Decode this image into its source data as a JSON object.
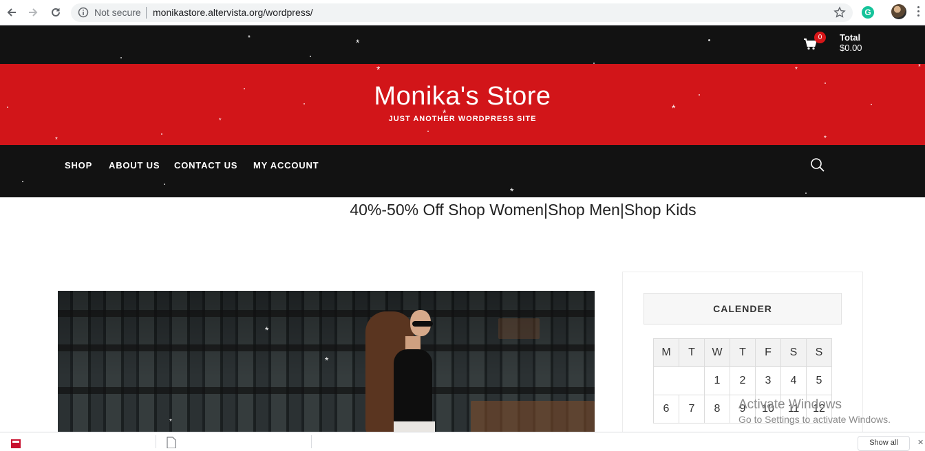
{
  "browser": {
    "security_label": "Not secure",
    "url": "monikastore.altervista.org/wordpress/",
    "extension_letter": "G"
  },
  "site": {
    "cart": {
      "count": "0",
      "total_label": "Total",
      "total_value": "$0.00"
    },
    "title": "Monika's Store",
    "tagline": "JUST ANOTHER WORDPRESS SITE",
    "nav": [
      "SHOP",
      "ABOUT US",
      "CONTACT US",
      "MY ACCOUNT"
    ],
    "promo": "40%-50% Off Shop Women|Shop Men|Shop Kids",
    "colors": {
      "topbar": "#121212",
      "banner": "#d21519",
      "badge": "#d71618"
    }
  },
  "calendar": {
    "title": "CALENDER",
    "days": [
      "M",
      "T",
      "W",
      "T",
      "F",
      "S",
      "S"
    ],
    "rows": [
      [
        "",
        "",
        "1",
        "2",
        "3",
        "4",
        "5"
      ],
      [
        "6",
        "7",
        "8",
        "9",
        "10",
        "11",
        "12"
      ]
    ]
  },
  "watermark": {
    "line1": "Activate Windows",
    "line2": "Go to Settings to activate Windows."
  },
  "downloads_bar": {
    "show_all": "Show all"
  }
}
